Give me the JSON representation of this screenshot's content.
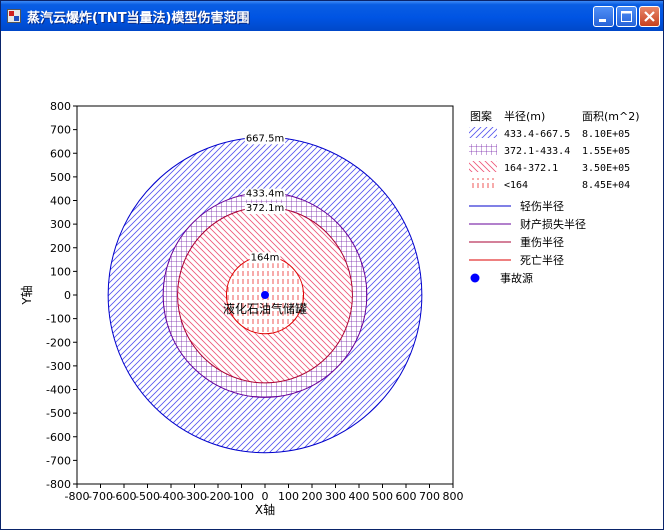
{
  "window": {
    "title": "蒸汽云爆炸(TNT当量法)模型伤害范围"
  },
  "chart_data": {
    "type": "scatter",
    "xlabel": "X轴",
    "ylabel": "Y轴",
    "xlim": [
      -800,
      800
    ],
    "ylim": [
      -800,
      800
    ],
    "ticks": [
      -800,
      -700,
      -600,
      -500,
      -400,
      -300,
      -200,
      -100,
      0,
      100,
      200,
      300,
      400,
      500,
      600,
      700,
      800
    ],
    "circles": [
      {
        "radius": 667.5,
        "label": "667.5m",
        "color": "#0000cc",
        "fill": "diag-right",
        "fill_color": "#5555ee"
      },
      {
        "radius": 433.4,
        "label": "433.4m",
        "color": "#660099",
        "fill": "grid",
        "fill_color": "#7722aa"
      },
      {
        "radius": 372.1,
        "label": "372.1m",
        "color": "#aa0033",
        "fill": "diag-left",
        "fill_color": "#ee5577"
      },
      {
        "radius": 164,
        "label": "164m",
        "color": "#dd0000",
        "fill": "vertical",
        "fill_color": "#ee4444"
      }
    ],
    "point": {
      "x": 0,
      "y": 0,
      "label": "液化石油气储罐",
      "color": "#0000ff"
    },
    "legend": {
      "position": "right",
      "headers": [
        "图案",
        "半径(m)",
        "面积(m^2)"
      ],
      "area_rows": [
        {
          "range": "433.4-667.5",
          "area": "8.10E+05"
        },
        {
          "range": "372.1-433.4",
          "area": "1.55E+05"
        },
        {
          "range": "164-372.1",
          "area": "3.50E+05"
        },
        {
          "range": "<164",
          "area": "8.45E+04"
        }
      ],
      "line_rows": [
        "轻伤半径",
        "财产损失半径",
        "重伤半径",
        "死亡半径"
      ],
      "point_row": "事故源"
    }
  }
}
